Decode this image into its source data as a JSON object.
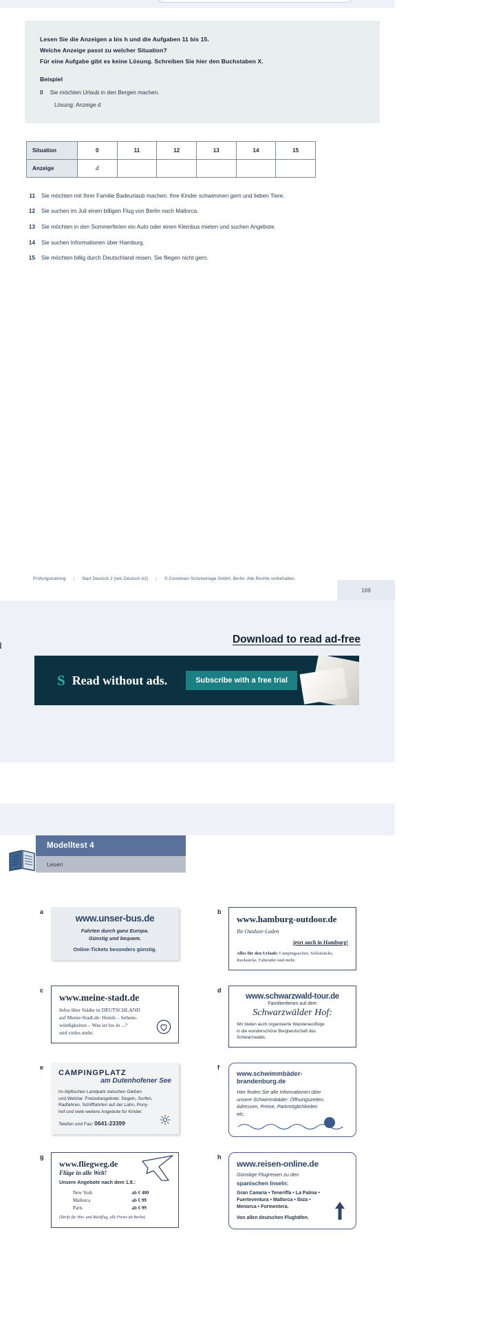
{
  "document": {
    "instructions": [
      "Lesen Sie die Anzeigen a bis h und die Aufgaben 11 bis 15.",
      "Welche Anzeige passt zu welcher Situation?",
      "Für eine Aufgabe gibt es keine Lösung. Schreiben Sie hier den Buchstaben X."
    ],
    "beispiel_label": "Beispiel",
    "example_number": "0",
    "example_text": "Sie möchten Urlaub in den Bergen machen.",
    "example_solution": "Lösung: Anzeige d",
    "table": {
      "row1_label": "Situation",
      "row2_label": "Anzeige",
      "columns": [
        "0",
        "11",
        "12",
        "13",
        "14",
        "15"
      ],
      "answers": [
        "d",
        "",
        "",
        "",
        "",
        ""
      ]
    },
    "questions": [
      {
        "num": "11",
        "text": "Sie möchten mit Ihrer Familie Badeurlaub machen. Ihre Kinder schwimmen gern und lieben Tiere."
      },
      {
        "num": "12",
        "text": "Sie suchen im Juli einen billigen Flug von Berlin nach Mallorca."
      },
      {
        "num": "13",
        "text": "Sie möchten in den Sommerferien ein Auto oder einen Kleinbus mieten und suchen Angebote."
      },
      {
        "num": "14",
        "text": "Sie suchen Informationen über Hamburg."
      },
      {
        "num": "15",
        "text": "Sie möchten billig durch Deutschland reisen. Sie fliegen nicht gern."
      }
    ],
    "footer": {
      "part1": "Prüfungstraining",
      "part2": "Start Deutsch 2 (telc Deutsch A2)",
      "part3": "© Cornelsen Schulverlage GmbH, Berlin. Alle Rechte vorbehalten.",
      "page_number": "169"
    }
  },
  "ad_band": {
    "left_word": "ad",
    "download_link": "Download to read ad-free",
    "logo_glyph": "S",
    "headline": "Read without ads.",
    "cta_label": "Subscribe with a free trial",
    "bg_color": "#0c3241",
    "cta_color": "#1c7f84",
    "logo_color": "#1fb99a"
  },
  "page2": {
    "header_title": "Modelltest 4",
    "header_sub": "Lesen",
    "header_color": "#5a719c",
    "header_sub_color": "#b7bec9",
    "ads": [
      {
        "letter": "a",
        "style": "grey",
        "url": "www.unser-bus.de",
        "lines": [
          "Fahrten durch ganz Europa.",
          "Günstig und bequem.",
          "Online-Tickets besonders günstig."
        ]
      },
      {
        "letter": "b",
        "style": "plain",
        "url": "www.hamburg-outdoor.de",
        "tagline": "Ihr Outdoor-Laden",
        "highlight": "jetzt auch in Hamburg!",
        "body_bold": "Alles für den Urlaub:",
        "body": " Campingsachen, Schlafsäcke, Rucksäcke, Fahrräder und mehr."
      },
      {
        "letter": "c",
        "style": "plain",
        "url": "www.meine-stadt.de",
        "lines": [
          "Infos über Städte in DEUTSCHLAND",
          "auf Meine-Stadt.de: Hotels – Sehens-",
          "würdigkeiten – Was ist los in ...?",
          "und vieles mehr."
        ],
        "icon": "heart-icon"
      },
      {
        "letter": "d",
        "style": "plain",
        "url": "www.schwarzwald-tour.de",
        "tagline": "Familienferien auf dem",
        "script_name": "Schwarzwälder Hof:",
        "lines": [
          "Wir bieten auch organisierte Wanderausflüge",
          "in die wunderschöne Berglandschaft des",
          "Schwarzwalds."
        ]
      },
      {
        "letter": "e",
        "style": "shadow",
        "title": "CAMPINGPLATZ",
        "subtitle": "am Dutenhofener See",
        "lines": [
          "im idyllischen Landpark zwischen Gießen",
          "und Wetzlar. Freizeitangebote: Segeln, Surfen,",
          "Radfahren, Schifffahrten auf der Lahn, Pony-",
          "hof und viele weitere Angebote für Kinder."
        ],
        "contact_label": "Telefon und Fax:",
        "contact_value": "0641-23399",
        "icon": "sun-icon"
      },
      {
        "letter": "f",
        "style": "round",
        "url": "www.schwimmbäder-brandenburg.de",
        "lines": [
          "Hier finden Sie alle Informationen über",
          "unsere Schwimmbäder: Öffnungszeiten,",
          "Adressen, Preise, Parkmöglichkeiten",
          "etc."
        ],
        "icon": "wave-icon"
      },
      {
        "letter": "g",
        "style": "plain",
        "url": "www.fliegweg.de",
        "tagline": "Flüge in alle Welt!",
        "offer_heading": "Unsere Angebote nach dem 1.8.:",
        "prices": [
          {
            "city": "New York",
            "price": "ab € 400"
          },
          {
            "city": "Mallorca",
            "price": "ab € 99"
          },
          {
            "city": "Paris",
            "price": "ab € 99"
          }
        ],
        "note": "(Tarife für Hin- und Rückflug, alle Preise ab Berlin)",
        "icon": "plane-icon"
      },
      {
        "letter": "h",
        "style": "round",
        "url": "www.reisen-online.de",
        "tagline": "Günstige Flugreisen zu den",
        "headline2": "spanischen Inseln:",
        "lines": [
          "Gran Canaria • Teneriffa • La Palma •",
          "Fuerteventura • Mallorca • Ibiza •",
          "Menorca • Formentera."
        ],
        "footer_line": "Von allen deutschen Flughäfen.",
        "icon": "arrow-up-icon"
      }
    ]
  }
}
